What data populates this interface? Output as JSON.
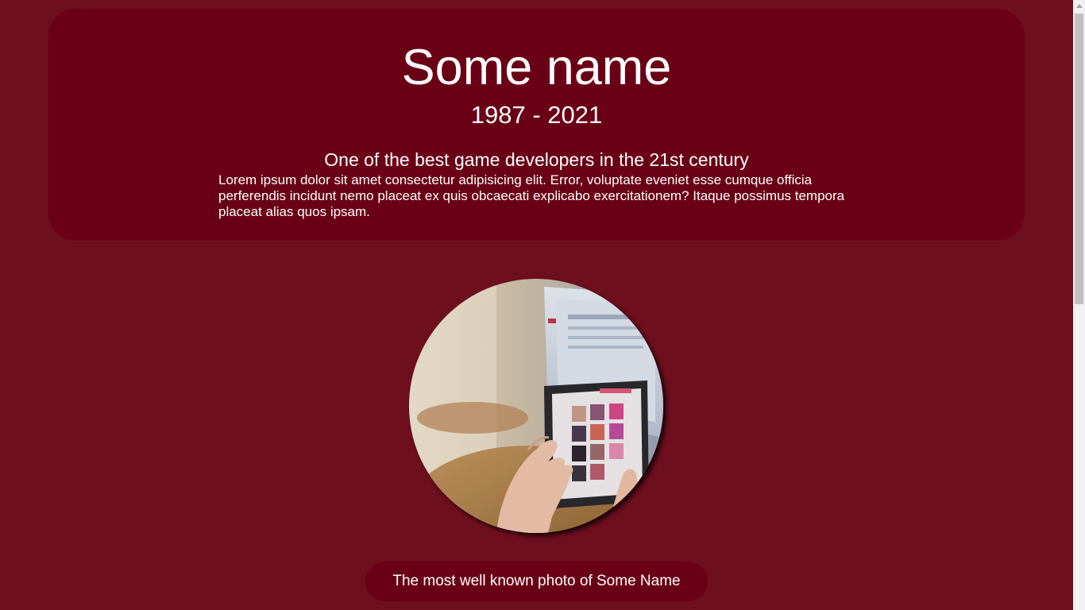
{
  "profile": {
    "name": "Some name",
    "years": "1987 - 2021",
    "tagline": "One of the best game developers in the 21st century",
    "bio": "Lorem ipsum dolor sit amet consectetur adipisicing elit. Error, voluptate eveniet esse cumque officia perferendis incidunt nemo placeat ex quis obcaecati explicabo exercitationem? Itaque possimus tempora placeat alias quos ipsam."
  },
  "photo": {
    "caption": "The most well known photo of Some Name"
  },
  "colors": {
    "page_background": "#6e0f1e",
    "card_background": "#6a0015",
    "text": "#ffffff"
  }
}
